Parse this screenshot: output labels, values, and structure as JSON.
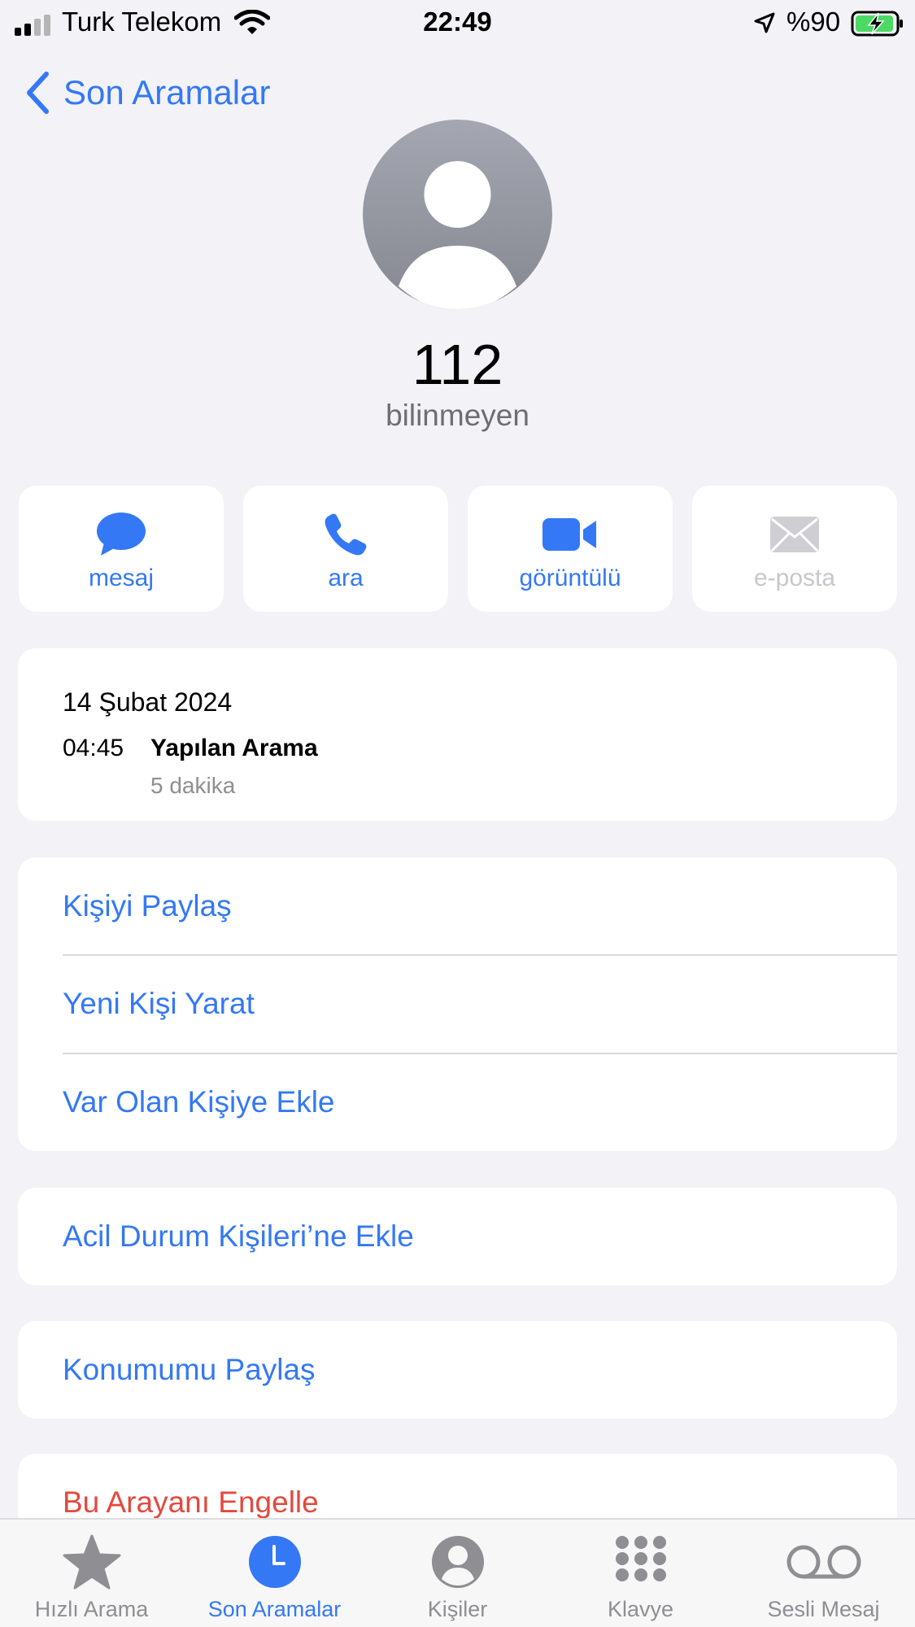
{
  "status_bar": {
    "carrier": "Turk Telekom",
    "time": "22:49",
    "battery": "%90"
  },
  "nav": {
    "back_label": "Son Aramalar"
  },
  "contact": {
    "name": "112",
    "subtitle": "bilinmeyen"
  },
  "actions": [
    {
      "label": "mesaj",
      "icon": "message-bubble-icon",
      "enabled": true
    },
    {
      "label": "ara",
      "icon": "phone-icon",
      "enabled": true
    },
    {
      "label": "görüntülü",
      "icon": "video-camera-icon",
      "enabled": true
    },
    {
      "label": "e-posta",
      "icon": "envelope-icon",
      "enabled": false
    }
  ],
  "call_history": {
    "date": "14 Şubat 2024",
    "time": "04:45",
    "type": "Yapılan Arama",
    "duration": "5 dakika"
  },
  "options_group1": [
    {
      "label": "Kişiyi Paylaş"
    },
    {
      "label": "Yeni Kişi Yarat"
    },
    {
      "label": "Var Olan Kişiye Ekle"
    }
  ],
  "options_group2": [
    {
      "label": "Acil Durum Kişileri’ne Ekle"
    }
  ],
  "options_group3": [
    {
      "label": "Konumumu Paylaş"
    }
  ],
  "options_group4": [
    {
      "label": "Bu Arayanı Engelle"
    }
  ],
  "tabs": [
    {
      "label": "Hızlı Arama",
      "icon": "star-icon",
      "active": false
    },
    {
      "label": "Son Aramalar",
      "icon": "clock-icon",
      "active": true
    },
    {
      "label": "Kişiler",
      "icon": "person-circle-icon",
      "active": false
    },
    {
      "label": "Klavye",
      "icon": "keypad-icon",
      "active": false
    },
    {
      "label": "Sesli Mesaj",
      "icon": "voicemail-icon",
      "active": false
    }
  ],
  "colors": {
    "accent": "#3478f6",
    "destructive": "#e5483d",
    "background": "#f2f2f7",
    "disabled": "#c7c7cc",
    "battery_green": "#4cd964"
  }
}
